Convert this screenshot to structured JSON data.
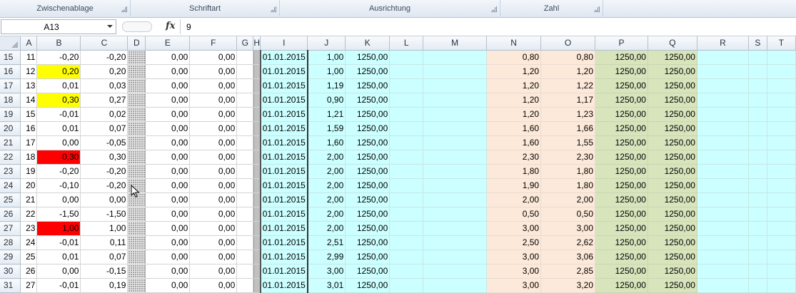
{
  "ribbon": {
    "groups": [
      {
        "label": "Zwischenablage"
      },
      {
        "label": "Schriftart"
      },
      {
        "label": "Ausrichtung"
      },
      {
        "label": "Zahl"
      },
      {
        "label": ""
      }
    ],
    "launcher_icon": "dialog-launcher-icon"
  },
  "formula_bar": {
    "name_box": "A13",
    "fx_label": "fx",
    "formula": "9"
  },
  "columns": [
    "A",
    "B",
    "C",
    "D",
    "E",
    "F",
    "G",
    "H",
    "I",
    "J",
    "K",
    "L",
    "M",
    "N",
    "O",
    "P",
    "Q",
    "R",
    "S",
    "T"
  ],
  "row_number_of_last_partial_row": "31",
  "rows": [
    {
      "row": "15",
      "A": "11",
      "B": "-0,20",
      "C": "-0,20",
      "E": "0,00",
      "F": "0,00",
      "I": "01.01.2015",
      "J": "1,00",
      "K": "1250,00",
      "N": "0,80",
      "O": "0,80",
      "P": "1250,00",
      "Q": "1250,00"
    },
    {
      "row": "16",
      "A": "12",
      "B": "0,20",
      "C": "0,20",
      "E": "0,00",
      "F": "0,00",
      "I": "01.01.2015",
      "J": "1,00",
      "K": "1250,00",
      "N": "1,20",
      "O": "1,20",
      "P": "1250,00",
      "Q": "1250,00",
      "Bfill": "yellow"
    },
    {
      "row": "17",
      "A": "13",
      "B": "0,01",
      "C": "0,03",
      "E": "0,00",
      "F": "0,00",
      "I": "01.01.2015",
      "J": "1,19",
      "K": "1250,00",
      "N": "1,20",
      "O": "1,22",
      "P": "1250,00",
      "Q": "1250,00"
    },
    {
      "row": "18",
      "A": "14",
      "B": "0,30",
      "C": "0,27",
      "E": "0,00",
      "F": "0,00",
      "I": "01.01.2015",
      "J": "0,90",
      "K": "1250,00",
      "N": "1,20",
      "O": "1,17",
      "P": "1250,00",
      "Q": "1250,00",
      "Bfill": "yellow"
    },
    {
      "row": "19",
      "A": "15",
      "B": "-0,01",
      "C": "0,02",
      "E": "0,00",
      "F": "0,00",
      "I": "01.01.2015",
      "J": "1,21",
      "K": "1250,00",
      "N": "1,20",
      "O": "1,23",
      "P": "1250,00",
      "Q": "1250,00"
    },
    {
      "row": "20",
      "A": "16",
      "B": "0,01",
      "C": "0,07",
      "E": "0,00",
      "F": "0,00",
      "I": "01.01.2015",
      "J": "1,59",
      "K": "1250,00",
      "N": "1,60",
      "O": "1,66",
      "P": "1250,00",
      "Q": "1250,00"
    },
    {
      "row": "21",
      "A": "17",
      "B": "0,00",
      "C": "-0,05",
      "E": "0,00",
      "F": "0,00",
      "I": "01.01.2015",
      "J": "1,60",
      "K": "1250,00",
      "N": "1,60",
      "O": "1,55",
      "P": "1250,00",
      "Q": "1250,00"
    },
    {
      "row": "22",
      "A": "18",
      "B": "0,30",
      "C": "0,30",
      "E": "0,00",
      "F": "0,00",
      "I": "01.01.2015",
      "J": "2,00",
      "K": "1250,00",
      "N": "2,30",
      "O": "2,30",
      "P": "1250,00",
      "Q": "1250,00",
      "Bfill": "red"
    },
    {
      "row": "23",
      "A": "19",
      "B": "-0,20",
      "C": "-0,20",
      "E": "0,00",
      "F": "0,00",
      "I": "01.01.2015",
      "J": "2,00",
      "K": "1250,00",
      "N": "1,80",
      "O": "1,80",
      "P": "1250,00",
      "Q": "1250,00"
    },
    {
      "row": "24",
      "A": "20",
      "B": "-0,10",
      "C": "-0,20",
      "E": "0,00",
      "F": "0,00",
      "I": "01.01.2015",
      "J": "2,00",
      "K": "1250,00",
      "N": "1,90",
      "O": "1,80",
      "P": "1250,00",
      "Q": "1250,00"
    },
    {
      "row": "25",
      "A": "21",
      "B": "0,00",
      "C": "0,00",
      "E": "0,00",
      "F": "0,00",
      "I": "01.01.2015",
      "J": "2,00",
      "K": "1250,00",
      "N": "2,00",
      "O": "2,00",
      "P": "1250,00",
      "Q": "1250,00"
    },
    {
      "row": "26",
      "A": "22",
      "B": "-1,50",
      "C": "-1,50",
      "E": "0,00",
      "F": "0,00",
      "I": "01.01.2015",
      "J": "2,00",
      "K": "1250,00",
      "N": "0,50",
      "O": "0,50",
      "P": "1250,00",
      "Q": "1250,00"
    },
    {
      "row": "27",
      "A": "23",
      "B": "1,00",
      "C": "1,00",
      "E": "0,00",
      "F": "0,00",
      "I": "01.01.2015",
      "J": "2,00",
      "K": "1250,00",
      "N": "3,00",
      "O": "3,00",
      "P": "1250,00",
      "Q": "1250,00",
      "Bfill": "red"
    },
    {
      "row": "28",
      "A": "24",
      "B": "-0,01",
      "C": "0,11",
      "E": "0,00",
      "F": "0,00",
      "I": "01.01.2015",
      "J": "2,51",
      "K": "1250,00",
      "N": "2,50",
      "O": "2,62",
      "P": "1250,00",
      "Q": "1250,00"
    },
    {
      "row": "29",
      "A": "25",
      "B": "0,01",
      "C": "0,07",
      "E": "0,00",
      "F": "0,00",
      "I": "01.01.2015",
      "J": "2,99",
      "K": "1250,00",
      "N": "3,00",
      "O": "3,06",
      "P": "1250,00",
      "Q": "1250,00"
    },
    {
      "row": "30",
      "A": "26",
      "B": "0,00",
      "C": "-0,15",
      "E": "0,00",
      "F": "0,00",
      "I": "01.01.2015",
      "J": "3,00",
      "K": "1250,00",
      "N": "3,00",
      "O": "2,85",
      "P": "1250,00",
      "Q": "1250,00"
    },
    {
      "row": "31",
      "A": "27",
      "B": "-0,01",
      "C": "0,19",
      "E": "0,00",
      "F": "0,00",
      "I": "01.01.2015",
      "J": "3,01",
      "K": "1250,00",
      "N": "3,00",
      "O": "3,20",
      "P": "1250,00",
      "Q": "1250,00"
    }
  ],
  "colors": {
    "cyan": "#ccffff",
    "peach": "#fde9d9",
    "green": "#d7e4bc",
    "yellow": "#ffff00",
    "red": "#ff0000"
  },
  "icons": {
    "name_box_dropdown": "chevron-down-icon",
    "cancel_enter": "formula-buttons-icon",
    "mouse_cursor": "mouse-pointer-icon"
  }
}
